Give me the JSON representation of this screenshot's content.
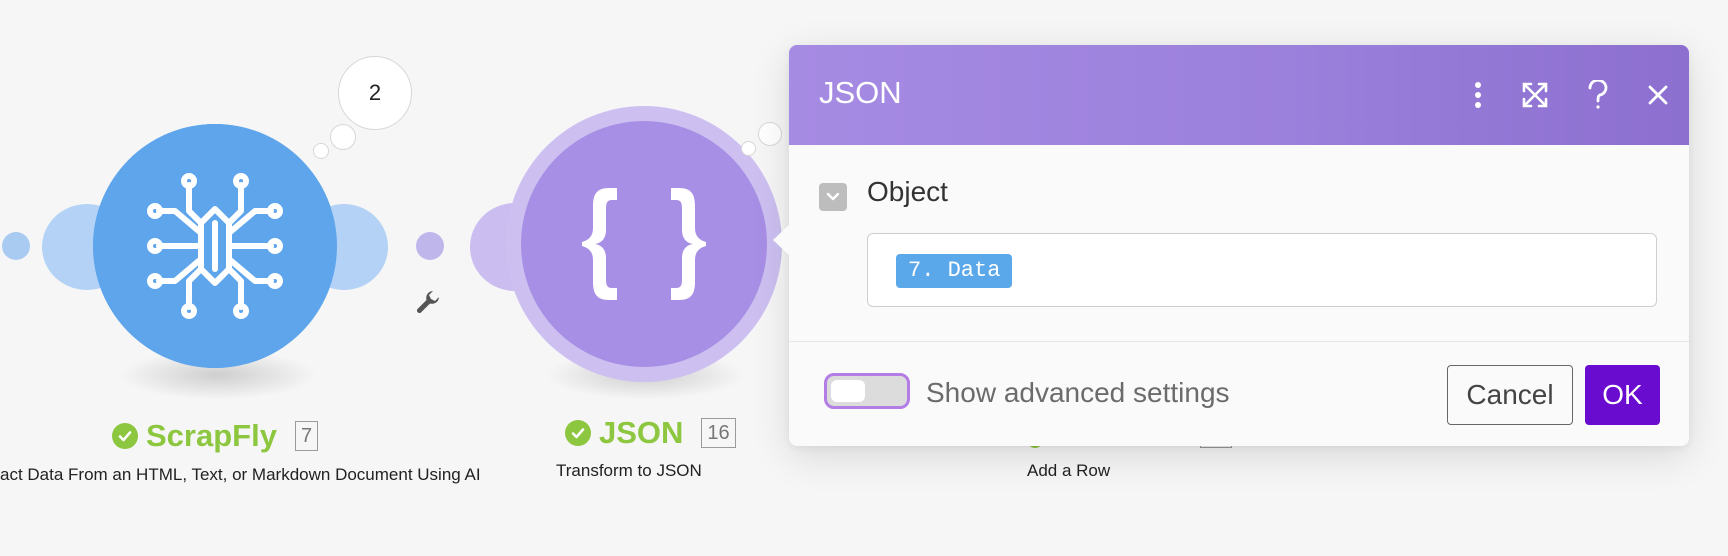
{
  "canvas": {
    "modules": [
      {
        "name": "ScrapFly",
        "id": "7",
        "subtitle": "act Data From an HTML, Text, or Markdown Document Using AI",
        "operations_count": "2",
        "icon": "spider-circuit-icon",
        "color": "#5ea5ec"
      },
      {
        "name": "JSON",
        "id": "16",
        "subtitle": "Transform to JSON",
        "icon": "curly-braces-icon",
        "color": "#a88fe6"
      },
      {
        "subtitle": "Add a Row"
      }
    ],
    "status_color": "#8dc63f",
    "wrench_icon": "wrench-icon"
  },
  "dialog": {
    "title": "JSON",
    "header_buttons": [
      "more-vertical-icon",
      "expand-icon",
      "help-icon",
      "close-icon"
    ],
    "header_color": "#9b80dc",
    "field": {
      "label": "Object",
      "value_pill": "7. Data"
    },
    "advanced_settings_label": "Show advanced settings",
    "cancel_label": "Cancel",
    "ok_label": "OK",
    "ok_color": "#6a0bd0"
  }
}
